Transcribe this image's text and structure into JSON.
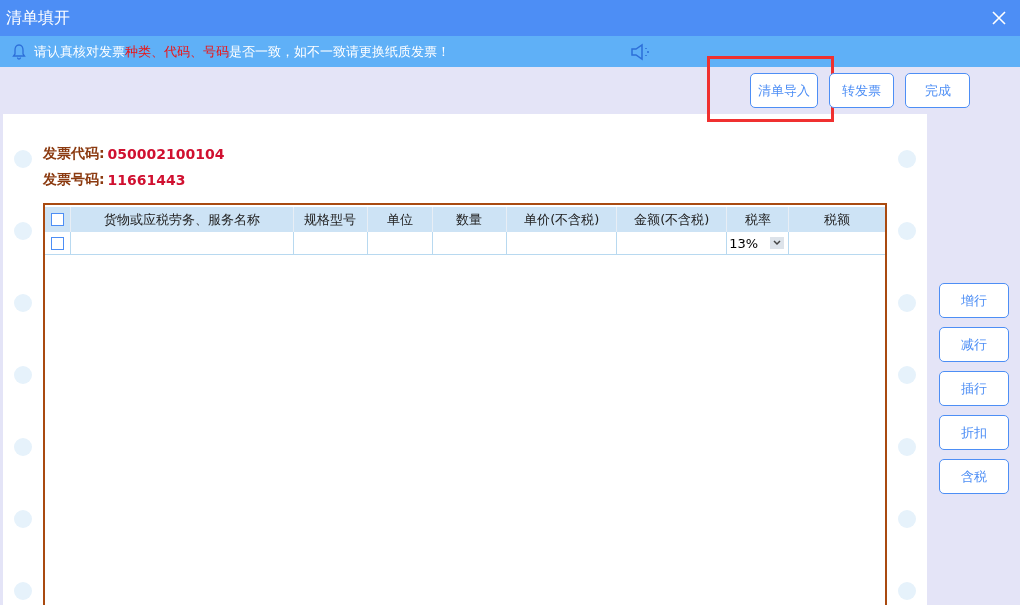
{
  "window": {
    "title": "清单填开"
  },
  "notice": {
    "parts": [
      {
        "text": "请认真核对发票",
        "kind": "normal"
      },
      {
        "text": "种类、代码、号码",
        "kind": "warning"
      },
      {
        "text": "是否一致，如不一致请更换纸质发票！",
        "kind": "normal"
      }
    ]
  },
  "top_buttons": [
    {
      "label": "清单导入",
      "highlighted": true
    },
    {
      "label": "转发票",
      "highlighted": false
    },
    {
      "label": "完成",
      "highlighted": false
    }
  ],
  "invoice": {
    "code_label": "发票代码:",
    "code": "050002100104",
    "number_label": "发票号码:",
    "number": "11661443"
  },
  "table": {
    "header_checked": false,
    "columns": [
      "货物或应税劳务、服务名称",
      "规格型号",
      "单位",
      "数量",
      "单价(不含税)",
      "金额(不含税)",
      "税率",
      "税额"
    ],
    "rows": [
      {
        "checked": false,
        "tax_rate": "13%"
      }
    ]
  },
  "side_buttons": [
    "增行",
    "减行",
    "插行",
    "折扣",
    "含税"
  ]
}
